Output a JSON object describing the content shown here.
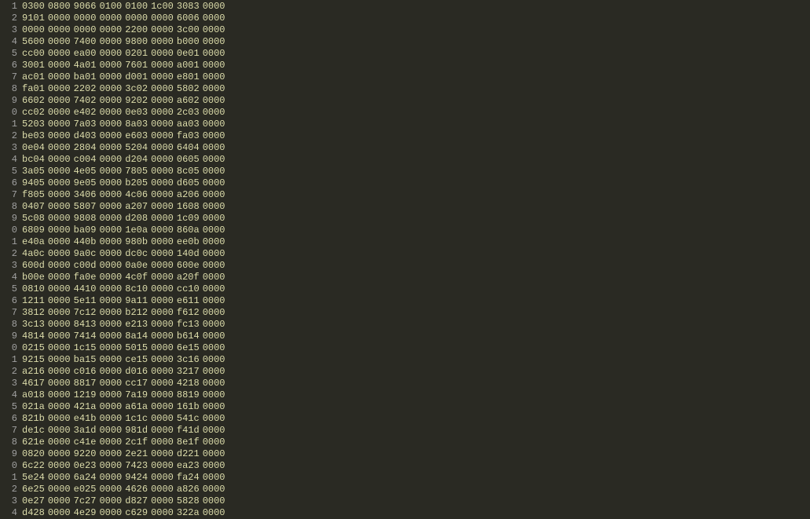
{
  "lines": [
    {
      "num": "1",
      "hex": [
        "0300",
        "0800",
        "9066",
        "0100",
        "0100",
        "1c00",
        "3083",
        "0000"
      ]
    },
    {
      "num": "2",
      "hex": [
        "9101",
        "0000",
        "0000",
        "0000",
        "0000",
        "0000",
        "6006",
        "0000"
      ]
    },
    {
      "num": "3",
      "hex": [
        "0000",
        "0000",
        "0000",
        "0000",
        "2200",
        "0000",
        "3c00",
        "0000"
      ]
    },
    {
      "num": "4",
      "hex": [
        "5600",
        "0000",
        "7400",
        "0000",
        "9800",
        "0000",
        "b000",
        "0000"
      ]
    },
    {
      "num": "5",
      "hex": [
        "cc00",
        "0000",
        "ea00",
        "0000",
        "0201",
        "0000",
        "0e01",
        "0000"
      ]
    },
    {
      "num": "6",
      "hex": [
        "3001",
        "0000",
        "4a01",
        "0000",
        "7601",
        "0000",
        "a001",
        "0000"
      ]
    },
    {
      "num": "7",
      "hex": [
        "ac01",
        "0000",
        "ba01",
        "0000",
        "d001",
        "0000",
        "e801",
        "0000"
      ]
    },
    {
      "num": "8",
      "hex": [
        "fa01",
        "0000",
        "2202",
        "0000",
        "3c02",
        "0000",
        "5802",
        "0000"
      ]
    },
    {
      "num": "9",
      "hex": [
        "6602",
        "0000",
        "7402",
        "0000",
        "9202",
        "0000",
        "a602",
        "0000"
      ]
    },
    {
      "num": "0",
      "hex": [
        "cc02",
        "0000",
        "e402",
        "0000",
        "0e03",
        "0000",
        "2c03",
        "0000"
      ]
    },
    {
      "num": "1",
      "hex": [
        "5203",
        "0000",
        "7a03",
        "0000",
        "8a03",
        "0000",
        "aa03",
        "0000"
      ]
    },
    {
      "num": "2",
      "hex": [
        "be03",
        "0000",
        "d403",
        "0000",
        "e603",
        "0000",
        "fa03",
        "0000"
      ]
    },
    {
      "num": "3",
      "hex": [
        "0e04",
        "0000",
        "2804",
        "0000",
        "5204",
        "0000",
        "6404",
        "0000"
      ]
    },
    {
      "num": "4",
      "hex": [
        "bc04",
        "0000",
        "c004",
        "0000",
        "d204",
        "0000",
        "0605",
        "0000"
      ]
    },
    {
      "num": "5",
      "hex": [
        "3a05",
        "0000",
        "4e05",
        "0000",
        "7805",
        "0000",
        "8c05",
        "0000"
      ]
    },
    {
      "num": "6",
      "hex": [
        "9405",
        "0000",
        "9e05",
        "0000",
        "b205",
        "0000",
        "d605",
        "0000"
      ]
    },
    {
      "num": "7",
      "hex": [
        "f805",
        "0000",
        "3406",
        "0000",
        "4c06",
        "0000",
        "a206",
        "0000"
      ]
    },
    {
      "num": "8",
      "hex": [
        "0407",
        "0000",
        "5807",
        "0000",
        "a207",
        "0000",
        "1608",
        "0000"
      ]
    },
    {
      "num": "9",
      "hex": [
        "5c08",
        "0000",
        "9808",
        "0000",
        "d208",
        "0000",
        "1c09",
        "0000"
      ]
    },
    {
      "num": "0",
      "hex": [
        "6809",
        "0000",
        "ba09",
        "0000",
        "1e0a",
        "0000",
        "860a",
        "0000"
      ]
    },
    {
      "num": "1",
      "hex": [
        "e40a",
        "0000",
        "440b",
        "0000",
        "980b",
        "0000",
        "ee0b",
        "0000"
      ]
    },
    {
      "num": "2",
      "hex": [
        "4a0c",
        "0000",
        "9a0c",
        "0000",
        "dc0c",
        "0000",
        "140d",
        "0000"
      ]
    },
    {
      "num": "3",
      "hex": [
        "600d",
        "0000",
        "c00d",
        "0000",
        "0a0e",
        "0000",
        "600e",
        "0000"
      ]
    },
    {
      "num": "4",
      "hex": [
        "b00e",
        "0000",
        "fa0e",
        "0000",
        "4c0f",
        "0000",
        "a20f",
        "0000"
      ]
    },
    {
      "num": "5",
      "hex": [
        "0810",
        "0000",
        "4410",
        "0000",
        "8c10",
        "0000",
        "cc10",
        "0000"
      ]
    },
    {
      "num": "6",
      "hex": [
        "1211",
        "0000",
        "5e11",
        "0000",
        "9a11",
        "0000",
        "e611",
        "0000"
      ]
    },
    {
      "num": "7",
      "hex": [
        "3812",
        "0000",
        "7c12",
        "0000",
        "b212",
        "0000",
        "f612",
        "0000"
      ]
    },
    {
      "num": "8",
      "hex": [
        "3c13",
        "0000",
        "8413",
        "0000",
        "e213",
        "0000",
        "fc13",
        "0000"
      ]
    },
    {
      "num": "9",
      "hex": [
        "4814",
        "0000",
        "7414",
        "0000",
        "8a14",
        "0000",
        "b614",
        "0000"
      ]
    },
    {
      "num": "0",
      "hex": [
        "0215",
        "0000",
        "1c15",
        "0000",
        "5015",
        "0000",
        "6e15",
        "0000"
      ]
    },
    {
      "num": "1",
      "hex": [
        "9215",
        "0000",
        "ba15",
        "0000",
        "ce15",
        "0000",
        "3c16",
        "0000"
      ]
    },
    {
      "num": "2",
      "hex": [
        "a216",
        "0000",
        "c016",
        "0000",
        "d016",
        "0000",
        "3217",
        "0000"
      ]
    },
    {
      "num": "3",
      "hex": [
        "4617",
        "0000",
        "8817",
        "0000",
        "cc17",
        "0000",
        "4218",
        "0000"
      ]
    },
    {
      "num": "4",
      "hex": [
        "a018",
        "0000",
        "1219",
        "0000",
        "7a19",
        "0000",
        "8819",
        "0000"
      ]
    },
    {
      "num": "5",
      "hex": [
        "021a",
        "0000",
        "421a",
        "0000",
        "a61a",
        "0000",
        "161b",
        "0000"
      ]
    },
    {
      "num": "6",
      "hex": [
        "821b",
        "0000",
        "e41b",
        "0000",
        "1c1c",
        "0000",
        "541c",
        "0000"
      ]
    },
    {
      "num": "7",
      "hex": [
        "de1c",
        "0000",
        "3a1d",
        "0000",
        "981d",
        "0000",
        "f41d",
        "0000"
      ]
    },
    {
      "num": "8",
      "hex": [
        "621e",
        "0000",
        "c41e",
        "0000",
        "2c1f",
        "0000",
        "8e1f",
        "0000"
      ]
    },
    {
      "num": "9",
      "hex": [
        "0820",
        "0000",
        "9220",
        "0000",
        "2e21",
        "0000",
        "d221",
        "0000"
      ]
    },
    {
      "num": "0",
      "hex": [
        "6c22",
        "0000",
        "0e23",
        "0000",
        "7423",
        "0000",
        "ea23",
        "0000"
      ]
    },
    {
      "num": "1",
      "hex": [
        "5e24",
        "0000",
        "6a24",
        "0000",
        "9424",
        "0000",
        "fa24",
        "0000"
      ]
    },
    {
      "num": "2",
      "hex": [
        "6e25",
        "0000",
        "e025",
        "0000",
        "4626",
        "0000",
        "a826",
        "0000"
      ]
    },
    {
      "num": "3",
      "hex": [
        "0e27",
        "0000",
        "7c27",
        "0000",
        "d827",
        "0000",
        "5828",
        "0000"
      ]
    },
    {
      "num": "4",
      "hex": [
        "d428",
        "0000",
        "4e29",
        "0000",
        "c629",
        "0000",
        "322a",
        "0000"
      ]
    }
  ]
}
